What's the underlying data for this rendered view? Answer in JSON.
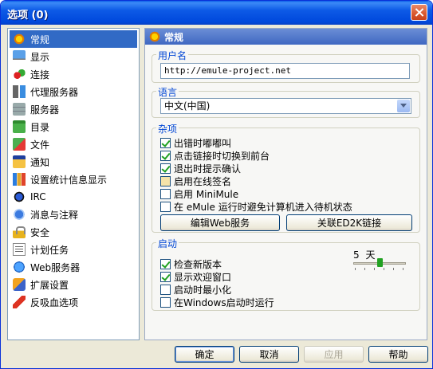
{
  "window": {
    "title": "选项 (0)"
  },
  "sidebar": {
    "items": [
      {
        "label": "常规",
        "icon": "general-icon"
      },
      {
        "label": "显示",
        "icon": "display-icon"
      },
      {
        "label": "连接",
        "icon": "connection-icon"
      },
      {
        "label": "代理服务器",
        "icon": "proxy-icon"
      },
      {
        "label": "服务器",
        "icon": "server-icon"
      },
      {
        "label": "目录",
        "icon": "folder-icon"
      },
      {
        "label": "文件",
        "icon": "files-icon"
      },
      {
        "label": "通知",
        "icon": "notify-icon"
      },
      {
        "label": "设置统计信息显示",
        "icon": "stats-icon"
      },
      {
        "label": "IRC",
        "icon": "irc-icon"
      },
      {
        "label": "消息与注释",
        "icon": "messages-icon"
      },
      {
        "label": "安全",
        "icon": "security-icon"
      },
      {
        "label": "计划任务",
        "icon": "scheduler-icon"
      },
      {
        "label": "Web服务器",
        "icon": "webserver-icon"
      },
      {
        "label": "扩展设置",
        "icon": "extended-icon"
      },
      {
        "label": "反吸血选项",
        "icon": "antileech-icon"
      }
    ],
    "selected_index": 0
  },
  "panel": {
    "header": "常规",
    "username": {
      "label": "用户名",
      "value": "http://emule-project.net"
    },
    "language": {
      "label": "语言",
      "value": "中文(中国)"
    },
    "misc": {
      "label": "杂项",
      "options": [
        {
          "label": "出错时嘟嘟叫",
          "checked": true
        },
        {
          "label": "点击链接时切换到前台",
          "checked": true
        },
        {
          "label": "退出时提示确认",
          "checked": true
        },
        {
          "label": "启用在线签名",
          "checked": false
        },
        {
          "label": "启用 MiniMule",
          "checked": false
        },
        {
          "label": "在 eMule 运行时避免计算机进入待机状态",
          "checked": false
        }
      ],
      "edit_web_label": "编辑Web服务",
      "assoc_ed2k_label": "关联ED2K链接"
    },
    "startup": {
      "label": "启动",
      "options": [
        {
          "label": "检查新版本",
          "checked": true
        },
        {
          "label": "显示欢迎窗口",
          "checked": true
        },
        {
          "label": "启动时最小化",
          "checked": false
        },
        {
          "label": "在Windows启动时运行",
          "checked": false
        }
      ],
      "days_value": "5",
      "days_unit": "天",
      "days_slider_fraction": 0.5
    }
  },
  "footer": {
    "ok_label": "确定",
    "cancel_label": "取消",
    "apply_label": "应用",
    "help_label": "帮助"
  }
}
